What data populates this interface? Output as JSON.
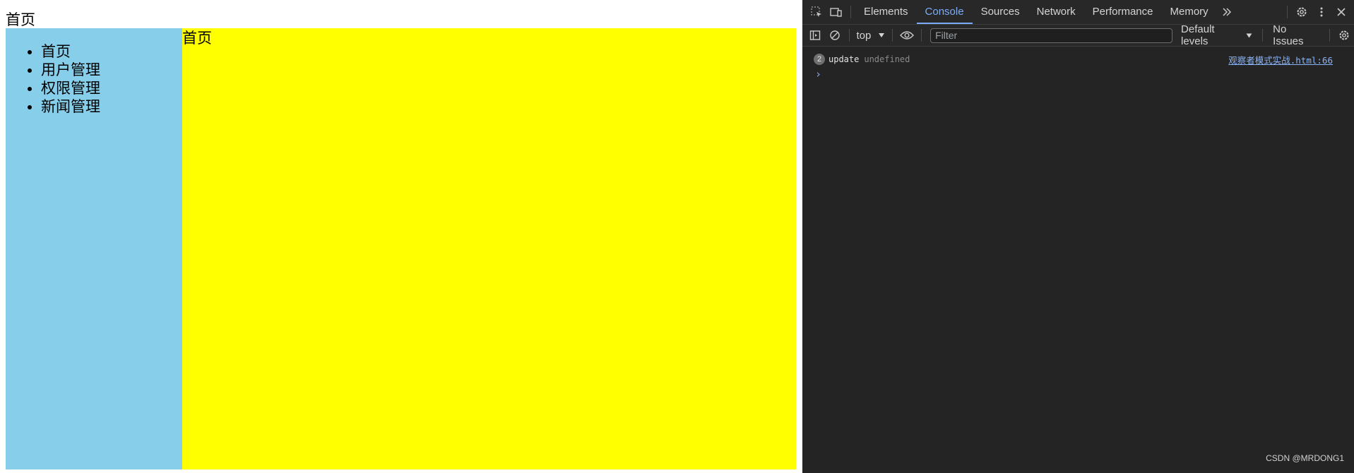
{
  "page": {
    "header": "首页",
    "sidebar_items": [
      "首页",
      "用户管理",
      "权限管理",
      "新闻管理"
    ],
    "content_title": "首页",
    "colors": {
      "sidebar_bg": "#87ceeb",
      "content_bg": "#ffff00"
    }
  },
  "devtools": {
    "tabs": [
      "Elements",
      "Console",
      "Sources",
      "Network",
      "Performance",
      "Memory"
    ],
    "active_tab": "Console",
    "toolbar": {
      "context": "top",
      "filter_placeholder": "Filter",
      "levels": "Default levels",
      "issues": "No Issues"
    },
    "console": {
      "message": {
        "count": "2",
        "text": "update",
        "value": "undefined",
        "source": "观察者模式实战.html:66"
      },
      "prompt": "›"
    },
    "watermark": "CSDN @MRDONG1"
  }
}
